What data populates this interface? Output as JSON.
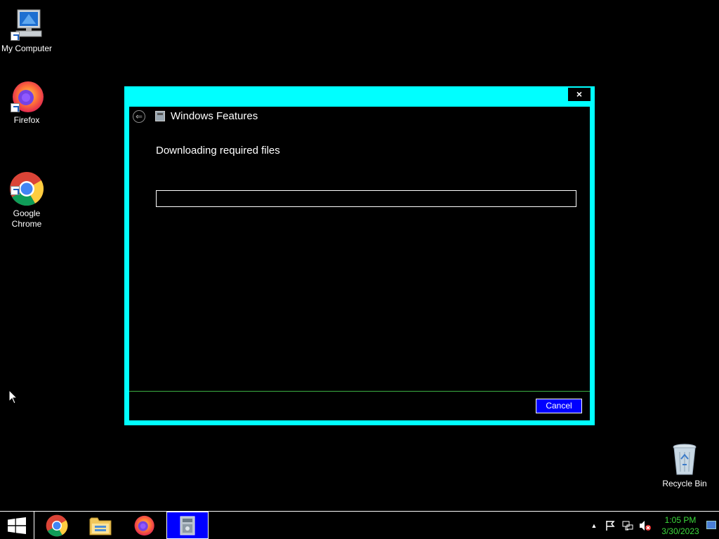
{
  "desktop": {
    "icons": [
      {
        "label": "My Computer"
      },
      {
        "label": "Firefox"
      },
      {
        "label": "Google\nChrome"
      },
      {
        "label": "Recycle Bin"
      }
    ]
  },
  "dialog": {
    "close_label": "×",
    "title": "Windows Features",
    "status": "Downloading required files",
    "progress": 0,
    "cancel_label": "Cancel"
  },
  "taskbar": {
    "apps": [
      "Google Chrome",
      "File Explorer",
      "Firefox",
      "Windows Features"
    ],
    "active_app": "Windows Features",
    "clock": {
      "time": "1:05 PM",
      "date": "3/30/2023"
    }
  },
  "colors": {
    "dialog_frame": "#00ffff",
    "accent_button": "#0000ff",
    "clock_text": "#3cdc3c",
    "divider": "#3cb043"
  }
}
